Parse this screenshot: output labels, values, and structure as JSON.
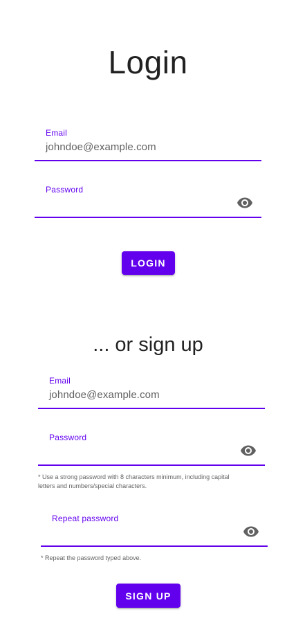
{
  "login": {
    "title": "Login",
    "email": {
      "label": "Email",
      "value": "johndoe@example.com"
    },
    "password": {
      "label": "Password",
      "value": "",
      "toggle_icon": "eye-icon"
    },
    "button_label": "Login"
  },
  "signup": {
    "title": "... or sign up",
    "email": {
      "label": "Email",
      "value": "johndoe@example.com"
    },
    "password": {
      "label": "Password",
      "value": "",
      "toggle_icon": "eye-icon",
      "helper": "* Use a strong password with 8 characters minimum, including capital letters and numbers/special characters."
    },
    "repeat_password": {
      "label": "Repeat password",
      "value": "",
      "toggle_icon": "eye-icon",
      "helper": "* Repeat the password typed above."
    },
    "button_label": "Sign up"
  },
  "colors": {
    "accent": "#6200ee",
    "text_primary": "#212121",
    "text_secondary": "#616161",
    "icon": "#616161",
    "background": "#ffffff"
  }
}
